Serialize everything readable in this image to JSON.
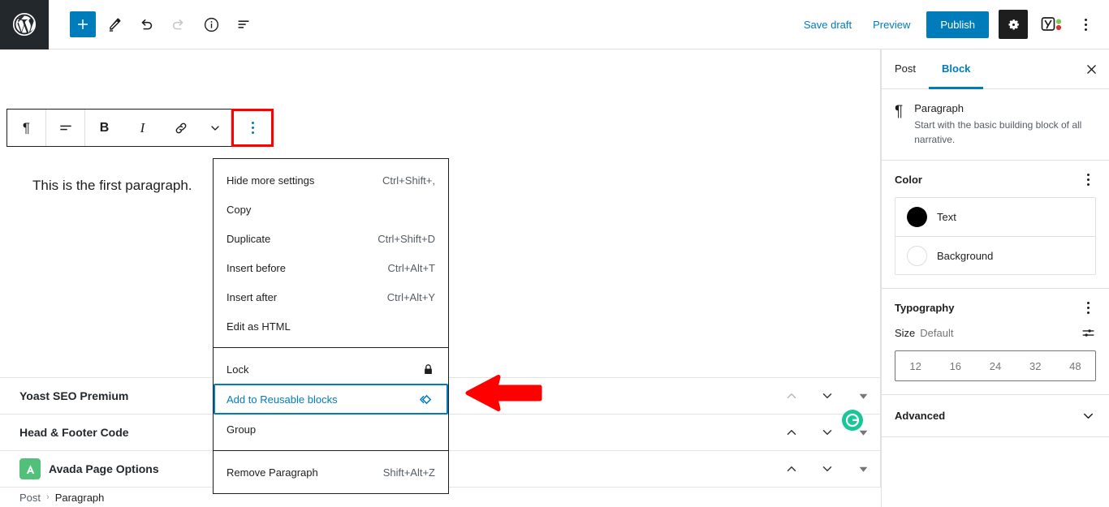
{
  "topbar": {
    "wp_logo": "wordpress-logo",
    "left_tools": [
      {
        "name": "add-block-button",
        "icon": "plus-icon",
        "label": "Add block"
      },
      {
        "name": "edit-tool-button",
        "icon": "pencil-icon",
        "label": "Tools"
      },
      {
        "name": "undo-button",
        "icon": "undo-arrow-icon",
        "label": "Undo"
      },
      {
        "name": "redo-button",
        "icon": "redo-arrow-icon",
        "label": "Redo",
        "disabled": true
      },
      {
        "name": "details-button",
        "icon": "info-circle-icon",
        "label": "Details"
      },
      {
        "name": "list-view-button",
        "icon": "list-view-icon",
        "label": "List view"
      }
    ],
    "save_draft": "Save draft",
    "preview": "Preview",
    "publish": "Publish",
    "settings_icon": "gear-icon",
    "yoast_icon": "yoast-seo-icon",
    "options_icon": "kebab-menu-icon"
  },
  "block_toolbar": {
    "items": [
      {
        "name": "block-type-button",
        "icon": "paragraph-pilcrow-icon",
        "glyph": "¶"
      },
      {
        "name": "align-text-button",
        "icon": "align-text-icon"
      },
      {
        "name": "bold-button",
        "icon": "bold-icon",
        "glyph": "B"
      },
      {
        "name": "italic-button",
        "icon": "italic-icon",
        "glyph": "I"
      },
      {
        "name": "link-button",
        "icon": "link-icon"
      },
      {
        "name": "more-rich-text-button",
        "icon": "chevron-down-icon"
      },
      {
        "name": "block-options-button",
        "icon": "kebab-menu-icon",
        "highlighted": true
      }
    ]
  },
  "editor": {
    "paragraph_text": "This is the first paragraph."
  },
  "dropdown": {
    "sections": [
      {
        "items": [
          {
            "label": "Hide more settings",
            "shortcut": "Ctrl+Shift+,",
            "name": "menu-item-hide-more-settings"
          },
          {
            "label": "Copy",
            "shortcut": "",
            "name": "menu-item-copy"
          },
          {
            "label": "Duplicate",
            "shortcut": "Ctrl+Shift+D",
            "name": "menu-item-duplicate"
          },
          {
            "label": "Insert before",
            "shortcut": "Ctrl+Alt+T",
            "name": "menu-item-insert-before"
          },
          {
            "label": "Insert after",
            "shortcut": "Ctrl+Alt+Y",
            "name": "menu-item-insert-after"
          },
          {
            "label": "Edit as HTML",
            "shortcut": "",
            "name": "menu-item-edit-as-html"
          }
        ]
      },
      {
        "items": [
          {
            "label": "Lock",
            "shortcut": "",
            "icon": "lock-icon",
            "name": "menu-item-lock"
          },
          {
            "label": "Add to Reusable blocks",
            "shortcut": "",
            "icon": "reusable-block-icon",
            "name": "menu-item-add-to-reusable-blocks",
            "focused": true
          },
          {
            "label": "Group",
            "shortcut": "",
            "name": "menu-item-group"
          }
        ]
      },
      {
        "items": [
          {
            "label": "Remove Paragraph",
            "shortcut": "Shift+Alt+Z",
            "name": "menu-item-remove-paragraph"
          }
        ]
      }
    ]
  },
  "metaboxes": {
    "rows": [
      {
        "title": "Yoast SEO Premium",
        "name": "metabox-yoast-seo-premium",
        "icon": null,
        "up_dim": true
      },
      {
        "title": "Head & Footer Code",
        "name": "metabox-head-footer-code",
        "icon": null,
        "up_dim": false
      },
      {
        "title": "Avada Page Options",
        "name": "metabox-avada-page-options",
        "icon": "avada-logo-icon",
        "up_dim": false
      }
    ],
    "badge_icon": "green-circle-icon"
  },
  "breadcrumb": {
    "items": [
      "Post",
      "Paragraph"
    ],
    "separator": "›"
  },
  "sidebar": {
    "tabs": [
      {
        "label": "Post",
        "name": "tab-post",
        "active": false
      },
      {
        "label": "Block",
        "name": "tab-block",
        "active": true
      }
    ],
    "close_icon": "close-icon",
    "block_info": {
      "icon": "paragraph-pilcrow-icon",
      "glyph": "¶",
      "title": "Paragraph",
      "description": "Start with the basic building block of all narrative."
    },
    "color_panel": {
      "title": "Color",
      "rows": [
        {
          "label": "Text",
          "swatch": "#000000",
          "name": "color-row-text"
        },
        {
          "label": "Background",
          "swatch": "#ffffff",
          "name": "color-row-background"
        }
      ]
    },
    "typography_panel": {
      "title": "Typography",
      "size_label": "Size",
      "size_value": "Default",
      "size_options": [
        "12",
        "16",
        "24",
        "32",
        "48"
      ]
    },
    "advanced_panel": {
      "title": "Advanced",
      "chevron": "chevron-down-icon"
    }
  },
  "annotation": {
    "arrow": "red-left-arrow",
    "arrow_color": "#ff0000",
    "highlight_color": "#ff0000"
  },
  "colors": {
    "accent": "#007cba",
    "dark": "#1e1e1e",
    "wp_black": "#23282d",
    "border": "#e0e0e0",
    "muted": "#757575",
    "avada_green": "#53c07a",
    "badge_green": "#19c69a"
  }
}
